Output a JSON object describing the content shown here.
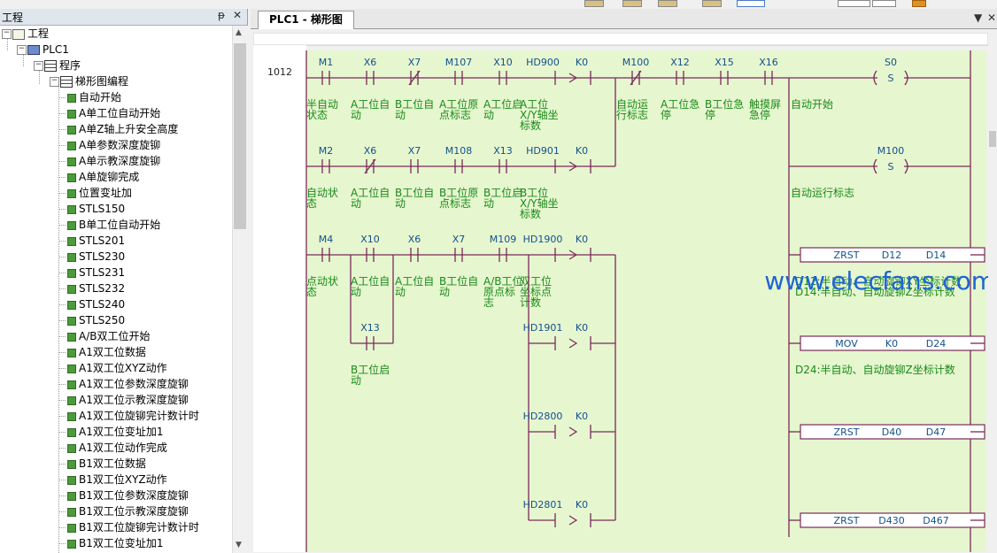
{
  "left_panel": {
    "title": "工程",
    "tree": [
      {
        "label": "工程",
        "depth": 0,
        "icon": "project-icon",
        "expander": "-"
      },
      {
        "label": "PLC1",
        "depth": 1,
        "icon": "plc-icon",
        "expander": "-"
      },
      {
        "label": "程序",
        "depth": 2,
        "icon": "program-icon",
        "expander": "-"
      },
      {
        "label": "梯形图编程",
        "depth": 3,
        "icon": "program-icon",
        "expander": "-"
      },
      {
        "label": "自动开始",
        "depth": 4,
        "icon": "block-icon"
      },
      {
        "label": "A单工位自动开始",
        "depth": 4,
        "icon": "block-icon"
      },
      {
        "label": "A单Z轴上升安全高度",
        "depth": 4,
        "icon": "block-icon"
      },
      {
        "label": "A单参数深度旋铆",
        "depth": 4,
        "icon": "block-icon"
      },
      {
        "label": "A单示教深度旋铆",
        "depth": 4,
        "icon": "block-icon"
      },
      {
        "label": "A单旋铆完成",
        "depth": 4,
        "icon": "block-icon"
      },
      {
        "label": "位置变址加",
        "depth": 4,
        "icon": "block-icon"
      },
      {
        "label": "STLS150",
        "depth": 4,
        "icon": "block-icon"
      },
      {
        "label": "B单工位自动开始",
        "depth": 4,
        "icon": "block-icon"
      },
      {
        "label": "STLS201",
        "depth": 4,
        "icon": "block-icon"
      },
      {
        "label": "STLS230",
        "depth": 4,
        "icon": "block-icon"
      },
      {
        "label": "STLS231",
        "depth": 4,
        "icon": "block-icon"
      },
      {
        "label": "STLS232",
        "depth": 4,
        "icon": "block-icon"
      },
      {
        "label": "STLS240",
        "depth": 4,
        "icon": "block-icon"
      },
      {
        "label": "STLS250",
        "depth": 4,
        "icon": "block-icon"
      },
      {
        "label": "A/B双工位开始",
        "depth": 4,
        "icon": "block-icon"
      },
      {
        "label": "A1双工位数据",
        "depth": 4,
        "icon": "block-icon"
      },
      {
        "label": "A1双工位XYZ动作",
        "depth": 4,
        "icon": "block-icon"
      },
      {
        "label": "A1双工位参数深度旋铆",
        "depth": 4,
        "icon": "block-icon"
      },
      {
        "label": "A1双工位示教深度旋铆",
        "depth": 4,
        "icon": "block-icon"
      },
      {
        "label": "A1双工位旋铆完计数计时",
        "depth": 4,
        "icon": "block-icon"
      },
      {
        "label": "A1双工位变址加1",
        "depth": 4,
        "icon": "block-icon"
      },
      {
        "label": "A1双工位动作完成",
        "depth": 4,
        "icon": "block-icon"
      },
      {
        "label": "B1双工位数据",
        "depth": 4,
        "icon": "block-icon"
      },
      {
        "label": "B1双工位XYZ动作",
        "depth": 4,
        "icon": "block-icon"
      },
      {
        "label": "B1双工位参数深度旋铆",
        "depth": 4,
        "icon": "block-icon"
      },
      {
        "label": "B1双工位示教深度旋铆",
        "depth": 4,
        "icon": "block-icon"
      },
      {
        "label": "B1双工位旋铆完计数计时",
        "depth": 4,
        "icon": "block-icon"
      },
      {
        "label": "B1双工位变址加1",
        "depth": 4,
        "icon": "block-icon"
      }
    ]
  },
  "editor": {
    "tab_label": "PLC1 - 梯形图",
    "step_number": "1012",
    "rung1": {
      "contacts": [
        {
          "addr": "M1",
          "type": "NO",
          "comment": [
            "半自动",
            "状态"
          ]
        },
        {
          "addr": "X6",
          "type": "NO",
          "comment": [
            "A工位自",
            "动"
          ]
        },
        {
          "addr": "X7",
          "type": "NC",
          "comment": [
            "B工位自",
            "动"
          ]
        },
        {
          "addr": "M107",
          "type": "NO",
          "comment": [
            "A工位原",
            "点标志"
          ]
        },
        {
          "addr": "X10",
          "type": "NO",
          "comment": [
            "A工位启",
            "动"
          ]
        }
      ],
      "compare": {
        "a": "HD900",
        "b": "K0",
        "comment": [
          "A工位",
          "X/Y轴坐",
          "标数"
        ]
      },
      "series": [
        {
          "addr": "M100",
          "type": "NC",
          "comment": [
            "自动运",
            "行标志"
          ]
        },
        {
          "addr": "X12",
          "type": "NO",
          "comment": [
            "A工位急",
            "停"
          ]
        },
        {
          "addr": "X15",
          "type": "NO",
          "comment": [
            "B工位急",
            "停"
          ]
        },
        {
          "addr": "X16",
          "type": "NO",
          "comment": [
            "触摸屏",
            "急停"
          ]
        }
      ],
      "coil": {
        "addr": "S0",
        "op": "S",
        "comment": "自动开始"
      }
    },
    "rung2": {
      "contacts": [
        {
          "addr": "M2",
          "type": "NO",
          "comment": [
            "自动状",
            "态"
          ]
        },
        {
          "addr": "X6",
          "type": "NC",
          "comment": [
            "A工位自",
            "动"
          ]
        },
        {
          "addr": "X7",
          "type": "NO",
          "comment": [
            "B工位自",
            "动"
          ]
        },
        {
          "addr": "M108",
          "type": "NO",
          "comment": [
            "B工位原",
            "点标志"
          ]
        },
        {
          "addr": "X13",
          "type": "NO",
          "comment": [
            "B工位启",
            "动"
          ]
        }
      ],
      "compare": {
        "a": "HD901",
        "b": "K0",
        "comment": [
          "B工位",
          "X/Y轴坐",
          "标数"
        ]
      },
      "coil": {
        "addr": "M100",
        "op": "S",
        "comment": "自动运行标志"
      }
    },
    "rung3": {
      "contacts": [
        {
          "addr": "M4",
          "type": "NO",
          "comment": [
            "点动状",
            "态"
          ]
        },
        {
          "addr": "X10",
          "type": "NO",
          "comment": [
            "A工位自",
            "动"
          ]
        },
        {
          "addr": "X6",
          "type": "NO",
          "comment": [
            "A工位自",
            "动"
          ]
        },
        {
          "addr": "X7",
          "type": "NO",
          "comment": [
            "B工位自",
            "动"
          ]
        },
        {
          "addr": "M109",
          "type": "NO",
          "comment": [
            "A/B工位",
            "原点标",
            "志"
          ]
        }
      ],
      "compare": {
        "a": "HD1900",
        "b": "K0",
        "comment": [
          "双工位",
          "坐标点",
          "计数"
        ]
      },
      "branch_contact": {
        "addr": "X13",
        "type": "NO",
        "comment": [
          "B工位启",
          "动"
        ]
      },
      "compares_more": [
        {
          "a": "HD1901",
          "b": "K0"
        },
        {
          "a": "HD2800",
          "b": "K0"
        },
        {
          "a": "HD2801",
          "b": "K0"
        }
      ],
      "outputs": [
        {
          "op": "ZRST",
          "p1": "D12",
          "p2": "D14",
          "comment": "D12:半自动、自动旋铆XY坐标计数",
          "comment2": "D14:半自动、自动旋铆Z坐标计数"
        },
        {
          "op": "MOV",
          "p1": "K0",
          "p2": "D24",
          "comment": "D24:半自动、自动旋铆Z坐标计数"
        },
        {
          "op": "ZRST",
          "p1": "D40",
          "p2": "D47"
        },
        {
          "op": "ZRST",
          "p1": "D430",
          "p2": "D467"
        }
      ]
    },
    "watermark": "www.elecfans.com"
  },
  "colors": {
    "ladder_bg": "#e6f6cf",
    "ladder_line": "#7a2a5a",
    "addr_text": "#14508c",
    "comment_text": "#1a8a1a",
    "watermark": "#1e64d2"
  }
}
